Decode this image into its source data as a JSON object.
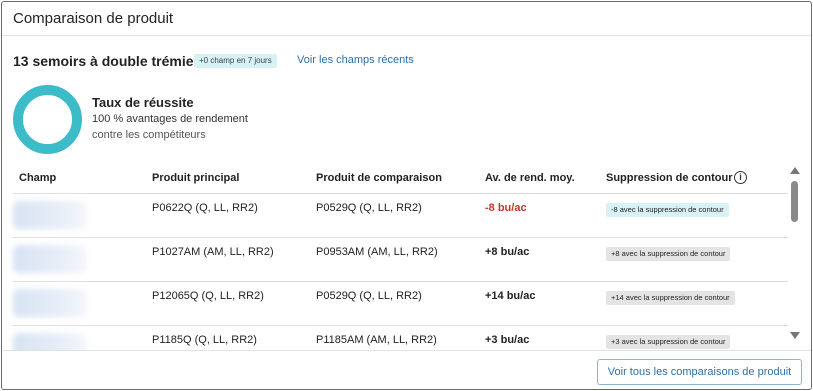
{
  "header": {
    "title": "Comparaison de produit"
  },
  "summary": {
    "title": "13 semoirs à double trémie",
    "badge": "+0 champ en 7 jours",
    "recent_link": "Voir les champs récents"
  },
  "success_rate": {
    "title": "Taux de réussite",
    "line1": "100 % avantages de rendement",
    "line2": "contre les compétiteurs",
    "ring_color": "#3cbcc9"
  },
  "table": {
    "columns": [
      "Champ",
      "Produit principal",
      "Produit de comparaison",
      "Av. de rend. moy.",
      "Suppression de contour"
    ],
    "info_icon": "info-icon",
    "rows": [
      {
        "primary": "P0622Q (Q, LL, RR2)",
        "comparison": "P0529Q (Q, LL, RR2)",
        "avg": "-8 bu/ac",
        "contour": "-8 avec la suppression de contour"
      },
      {
        "primary": "P1027AM (AM, LL, RR2)",
        "comparison": "P0953AM (AM, LL, RR2)",
        "avg": "+8 bu/ac",
        "contour": "+8 avec la suppression de contour"
      },
      {
        "primary": "P12065Q (Q, LL, RR2)",
        "comparison": "P0529Q (Q, LL, RR2)",
        "avg": "+14 bu/ac",
        "contour": "+14 avec la suppression de contour"
      },
      {
        "primary": "P1185Q (Q, LL, RR2)",
        "comparison": "P1185AM (AM, LL, RR2)",
        "avg": "+3 bu/ac",
        "contour": "+3 avec la suppression de contour"
      }
    ]
  },
  "footer": {
    "button_label": "Voir tous les comparaisons de produit"
  },
  "colors": {
    "negative": "#c0392b",
    "link": "#2f6fa8",
    "accent_badge": "#d8f1f5"
  }
}
